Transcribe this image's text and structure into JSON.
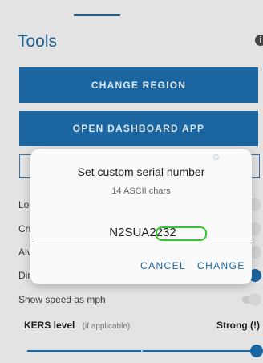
{
  "header": {
    "title": "Tools",
    "info_icon": "info-icon"
  },
  "buttons": {
    "change_region": "CHANGE REGION",
    "open_dashboard": "OPEN DASHBOARD APP"
  },
  "settings": [
    {
      "label": "Lo",
      "on": false
    },
    {
      "label": "Cru",
      "on": false
    },
    {
      "label": "Alv",
      "on": false
    },
    {
      "label": "Dir",
      "on": true
    },
    {
      "label": "Show speed as mph",
      "on": false
    }
  ],
  "kers": {
    "label": "KERS level",
    "hint": "(if applicable)",
    "value": "Strong (!)",
    "level_fraction": 1.0
  },
  "dialog": {
    "title": "Set custom serial number",
    "subtitle": "14 ASCII chars",
    "input_value": "N2SUA2232",
    "cancel_label": "CANCEL",
    "change_label": "CHANGE"
  },
  "colors": {
    "accent": "#1b66a1",
    "background": "#e3e3e3",
    "redaction": "#38c436"
  }
}
